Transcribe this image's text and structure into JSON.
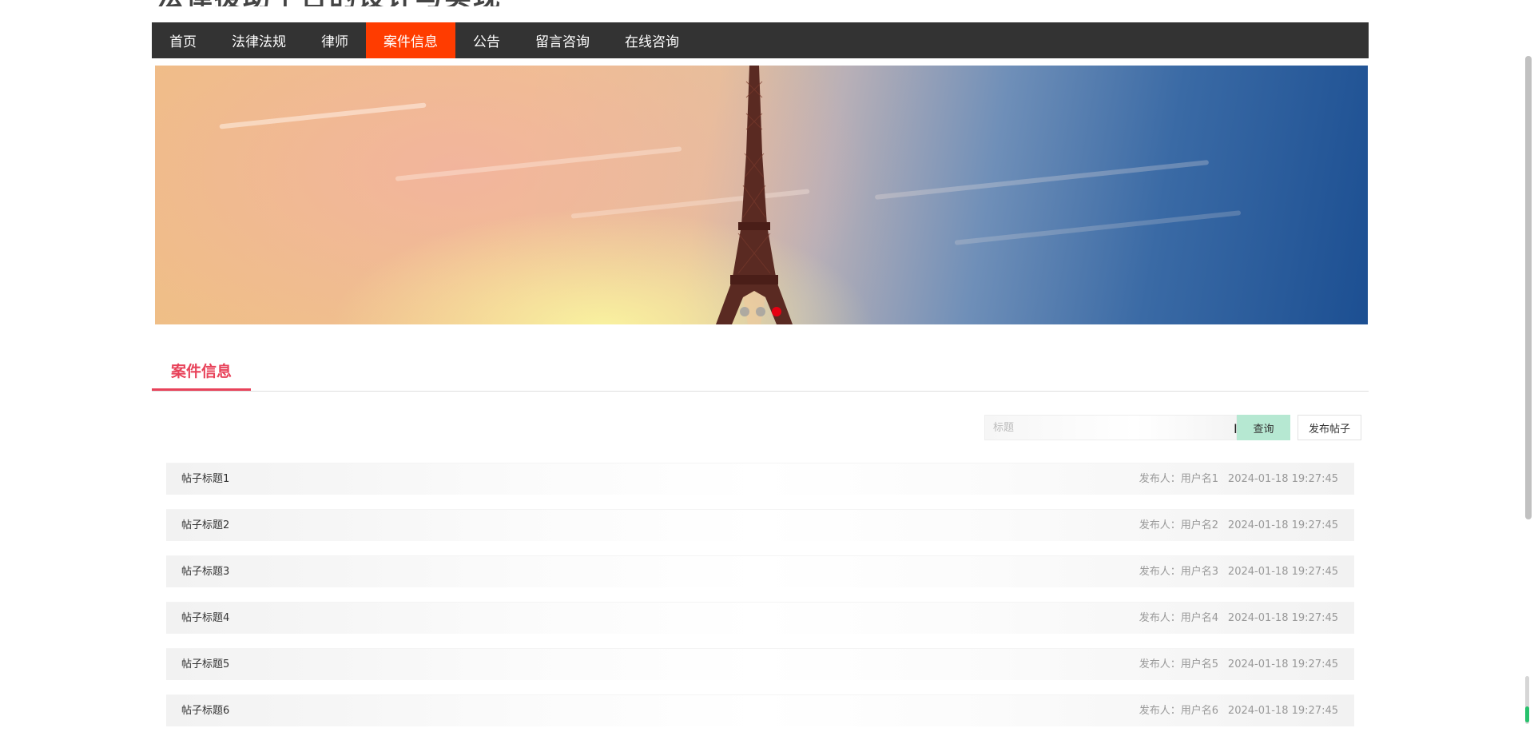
{
  "site": {
    "title": "法律援助平台的设计与实现"
  },
  "nav": {
    "items": [
      {
        "label": "首页"
      },
      {
        "label": "法律法规"
      },
      {
        "label": "律师"
      },
      {
        "label": "案件信息"
      },
      {
        "label": "公告"
      },
      {
        "label": "留言咨询"
      },
      {
        "label": "在线咨询"
      }
    ],
    "active_index": 3,
    "active_color": "#ff3c00",
    "bar_color": "#333333"
  },
  "banner": {
    "slide_count": 3,
    "active_slide": 3,
    "active_dot_color": "#e60012"
  },
  "section": {
    "title": "案件信息",
    "accent_color": "#e8425a"
  },
  "search": {
    "placeholder": "标题",
    "value": "",
    "query_label": "查询",
    "post_label": "发布帖子",
    "query_color": "#b6e8d2"
  },
  "posts": [
    {
      "title": "帖子标题1",
      "author": "发布人：用户名1",
      "time": "2024-01-18 19:27:45"
    },
    {
      "title": "帖子标题2",
      "author": "发布人：用户名2",
      "time": "2024-01-18 19:27:45"
    },
    {
      "title": "帖子标题3",
      "author": "发布人：用户名3",
      "time": "2024-01-18 19:27:45"
    },
    {
      "title": "帖子标题4",
      "author": "发布人：用户名4",
      "time": "2024-01-18 19:27:45"
    },
    {
      "title": "帖子标题5",
      "author": "发布人：用户名5",
      "time": "2024-01-18 19:27:45"
    },
    {
      "title": "帖子标题6",
      "author": "发布人：用户名6",
      "time": "2024-01-18 19:27:45"
    }
  ]
}
